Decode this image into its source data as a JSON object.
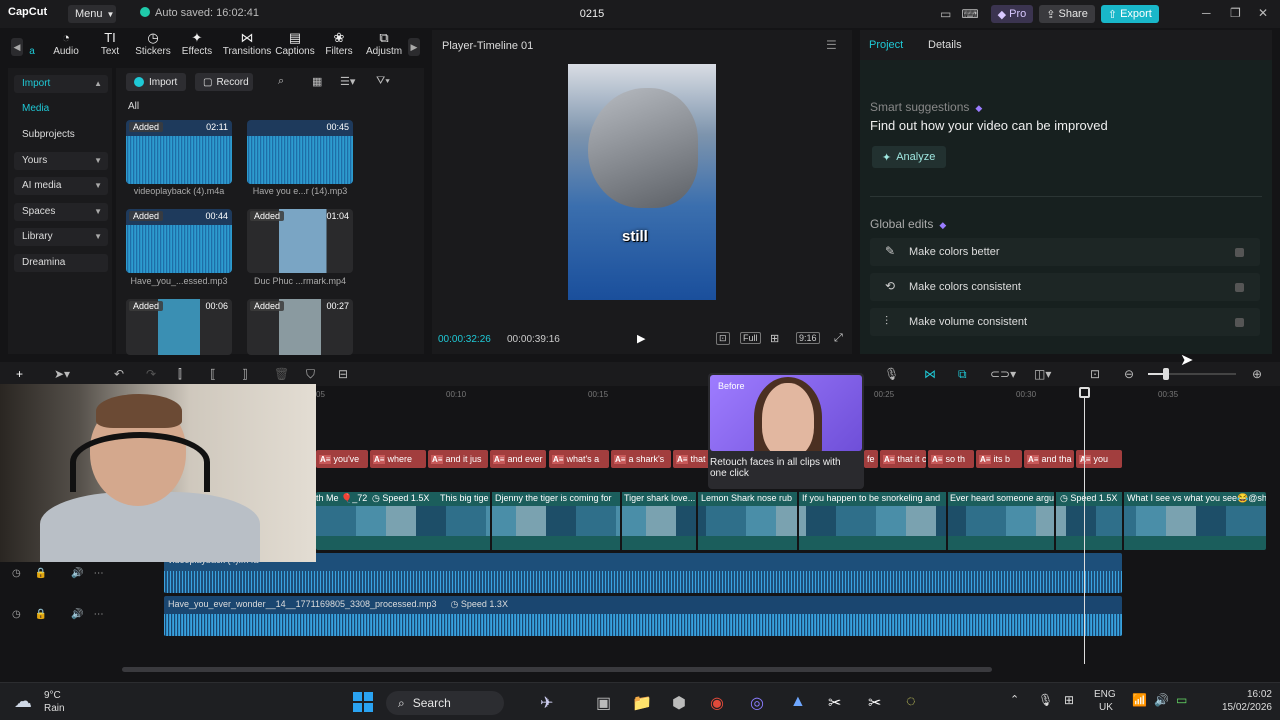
{
  "titlebar": {
    "logo": "CapCut",
    "menu": "Menu",
    "autosave": "Auto saved: 16:02:41",
    "project": "0215",
    "pro": "Pro",
    "share": "Share",
    "export": "Export"
  },
  "toolbar": {
    "items": [
      "a",
      "Audio",
      "Text",
      "Stickers",
      "Effects",
      "Transitions",
      "Captions",
      "Filters",
      "Adjustm"
    ]
  },
  "left_nav": {
    "import": "Import",
    "media": "Media",
    "subprojects": "Subprojects",
    "yours": "Yours",
    "ai_media": "AI media",
    "spaces": "Spaces",
    "library": "Library",
    "dreamina": "Dreamina"
  },
  "media": {
    "import_btn": "Import",
    "record_btn": "Record",
    "all_tab": "All",
    "items": [
      {
        "badge": "Added",
        "duration": "02:11",
        "caption": "videoplayback (4).m4a"
      },
      {
        "badge": "",
        "duration": "00:45",
        "caption": "Have you e...r (14).mp3"
      },
      {
        "badge": "Added",
        "duration": "00:44",
        "caption": "Have_you_...essed.mp3"
      },
      {
        "badge": "Added",
        "duration": "01:04",
        "caption": "Duc Phuc ...rmark.mp4"
      },
      {
        "badge": "Added",
        "duration": "00:06",
        "caption": ""
      },
      {
        "badge": "Added",
        "duration": "00:27",
        "caption": ""
      }
    ]
  },
  "player": {
    "title": "Player-Timeline 01",
    "caption": "still",
    "time_current": "00:00:32:26",
    "time_total": "00:00:39:16",
    "full": "Full",
    "ratio": "9:16"
  },
  "right_panel": {
    "tab_project": "Project",
    "tab_details": "Details",
    "smart_title": "Smart suggestions",
    "smart_head": "Find out how your video can be improved",
    "analyze": "Analyze",
    "global_title": "Global edits",
    "edits": [
      "Make colors better",
      "Make colors consistent",
      "Make volume consistent"
    ]
  },
  "ruler": {
    "ticks": [
      "05",
      "00:10",
      "00:15",
      "00:25",
      "00:30",
      "00:35"
    ]
  },
  "captions_track": [
    "you've",
    "where",
    "and it jus",
    "and ever",
    "what's a",
    "a shark's",
    "that detec",
    "fe",
    "that it c",
    "so th",
    "its b",
    "and tha",
    "you"
  ],
  "video_track": {
    "labels": [
      "th Me 🎈_72",
      "Speed 1.5X",
      "This big tige",
      "Djenny the tiger is coming for",
      "Tiger shark love...",
      "Lemon Shark nose rub",
      "If you happen to be snorkeling and",
      "Ever heard someone argu",
      "Speed 1.5X",
      "What I see vs what you see😂@sh"
    ]
  },
  "audio_tracks": [
    {
      "label": "videoplayback (4).m4a",
      "speed": ""
    },
    {
      "label": "Have_you_ever_wonder__14__1771169805_3308_processed.mp3",
      "speed": "Speed 1.3X"
    }
  ],
  "popup": {
    "before": "Before",
    "text": "Retouch faces in all clips with one click"
  },
  "taskbar": {
    "temp": "9°C",
    "condition": "Rain",
    "search": "Search",
    "lang1": "ENG",
    "lang2": "UK",
    "time": "16:02",
    "date": "15/02/2026"
  }
}
